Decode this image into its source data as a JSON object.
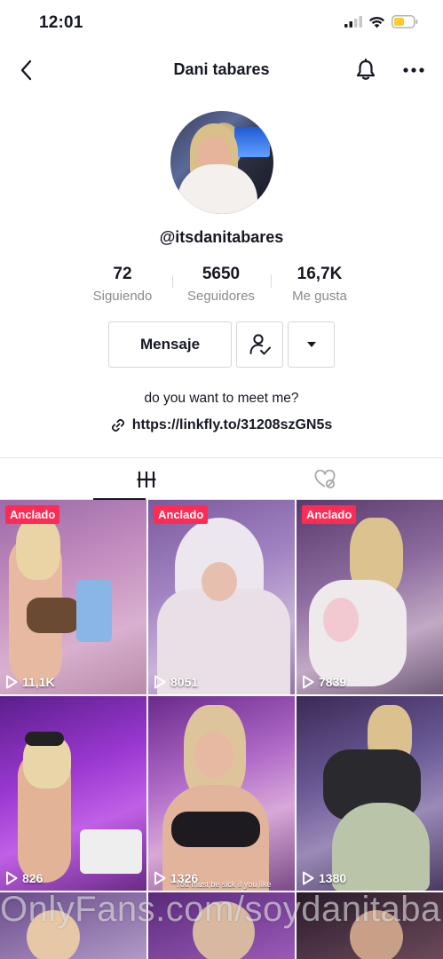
{
  "status": {
    "time": "12:01"
  },
  "nav": {
    "title": "Dani tabares"
  },
  "profile": {
    "handle": "@itsdanitabares",
    "bio": "do you want to meet me?",
    "link": "https://linkfly.to/31208szGN5s"
  },
  "stats": [
    {
      "value": "72",
      "label": "Siguiendo"
    },
    {
      "value": "5650",
      "label": "Seguidores"
    },
    {
      "value": "16,7K",
      "label": "Me gusta"
    }
  ],
  "actions": {
    "message_label": "Mensaje"
  },
  "videos": [
    {
      "pinned": "Anclado",
      "views": "11,1K"
    },
    {
      "pinned": "Anclado",
      "views": "8051"
    },
    {
      "pinned": "Anclado",
      "views": "7839"
    },
    {
      "views": "826"
    },
    {
      "views": "1326",
      "caption": "You must be sick if you like"
    },
    {
      "views": "1380"
    }
  ],
  "watermark": "OnlyFans.com/soydanitabar",
  "colors": {
    "pinned_badge": "#fe2c55",
    "text_primary": "#161823",
    "text_secondary": "#8a8b91"
  }
}
